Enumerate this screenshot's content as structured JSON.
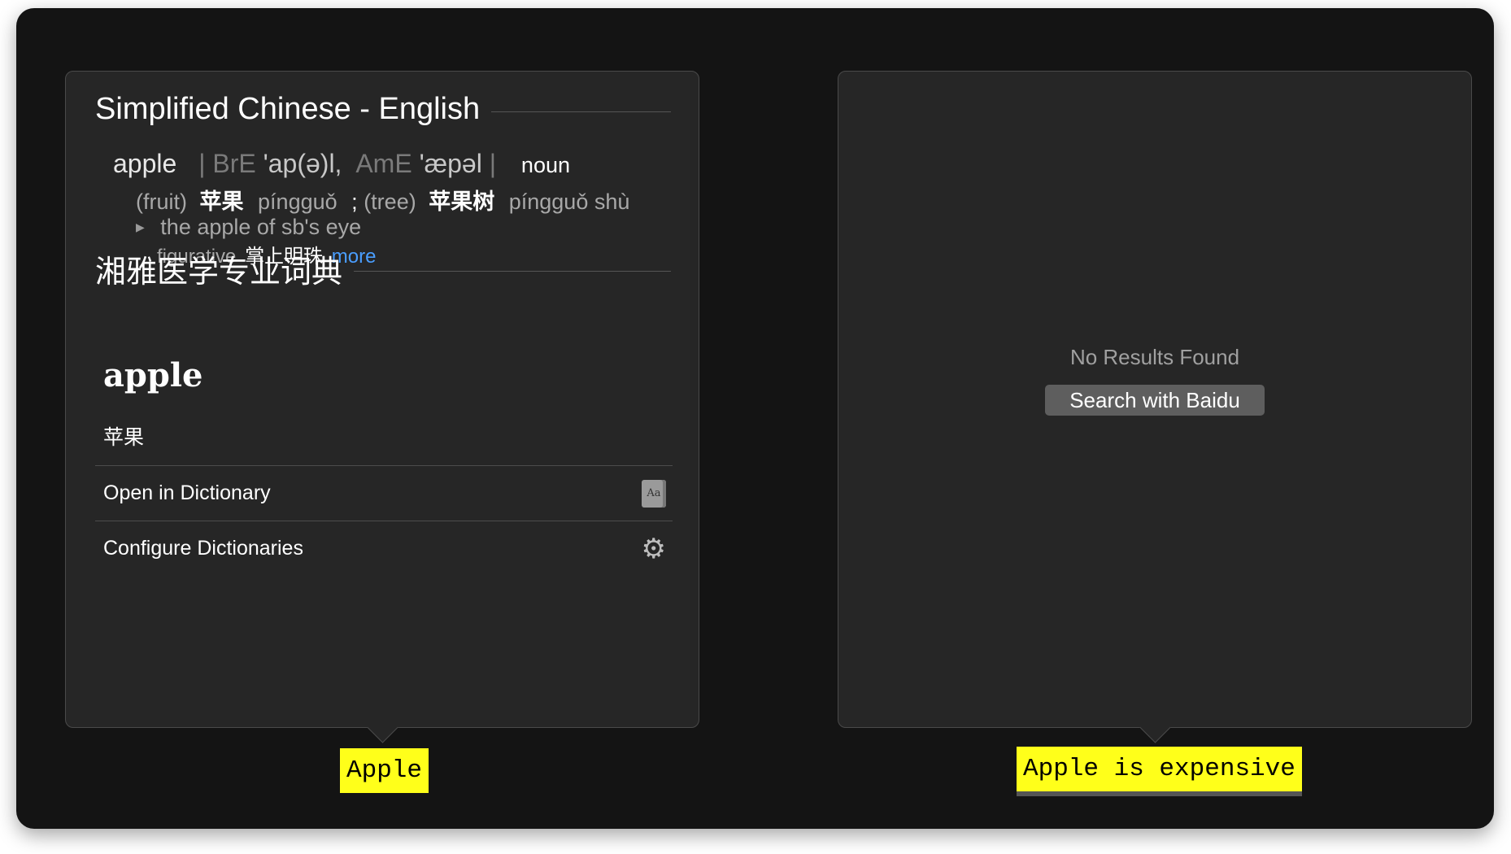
{
  "left_popover": {
    "section1_title": "Simplified Chinese - English",
    "headword": "apple",
    "pron_sep1": "| BrE",
    "pron_bre": "'ap(ə)l,",
    "pron_ame_label": "AmE",
    "pron_ame": "'æpəl",
    "pron_sep2": "|",
    "part_of_speech": "noun",
    "sense_fruit_label": "(fruit)",
    "sense_fruit_hz": "苹果",
    "sense_fruit_pinyin": "píngguǒ",
    "sense_sep": ";",
    "sense_tree_label": "(tree)",
    "sense_tree_hz": "苹果树",
    "sense_tree_pinyin": "píngguǒ shù",
    "phrase": "the apple of sb's eye",
    "phrase_register": "figurative",
    "phrase_hz": "掌上明珠",
    "more_link": "more",
    "section2_title": "湘雅医学专业词典",
    "entry_word": "apple",
    "entry_translation": "苹果",
    "menu_open": "Open in Dictionary",
    "menu_configure": "Configure Dictionaries",
    "dict_icon_text": "Aa"
  },
  "right_popover": {
    "no_results": "No Results Found",
    "search_button": "Search with Baidu"
  },
  "highlights": {
    "left": "Apple",
    "right": "Apple is expensive"
  },
  "icons": {
    "gear": "gear-icon",
    "dictionary": "dictionary-app-icon",
    "disclosure": "disclosure-triangle-icon"
  },
  "colors": {
    "highlight": "#ffff1a",
    "link": "#4a9eff",
    "popover_bg": "#262626",
    "window_bg": "#141414"
  }
}
